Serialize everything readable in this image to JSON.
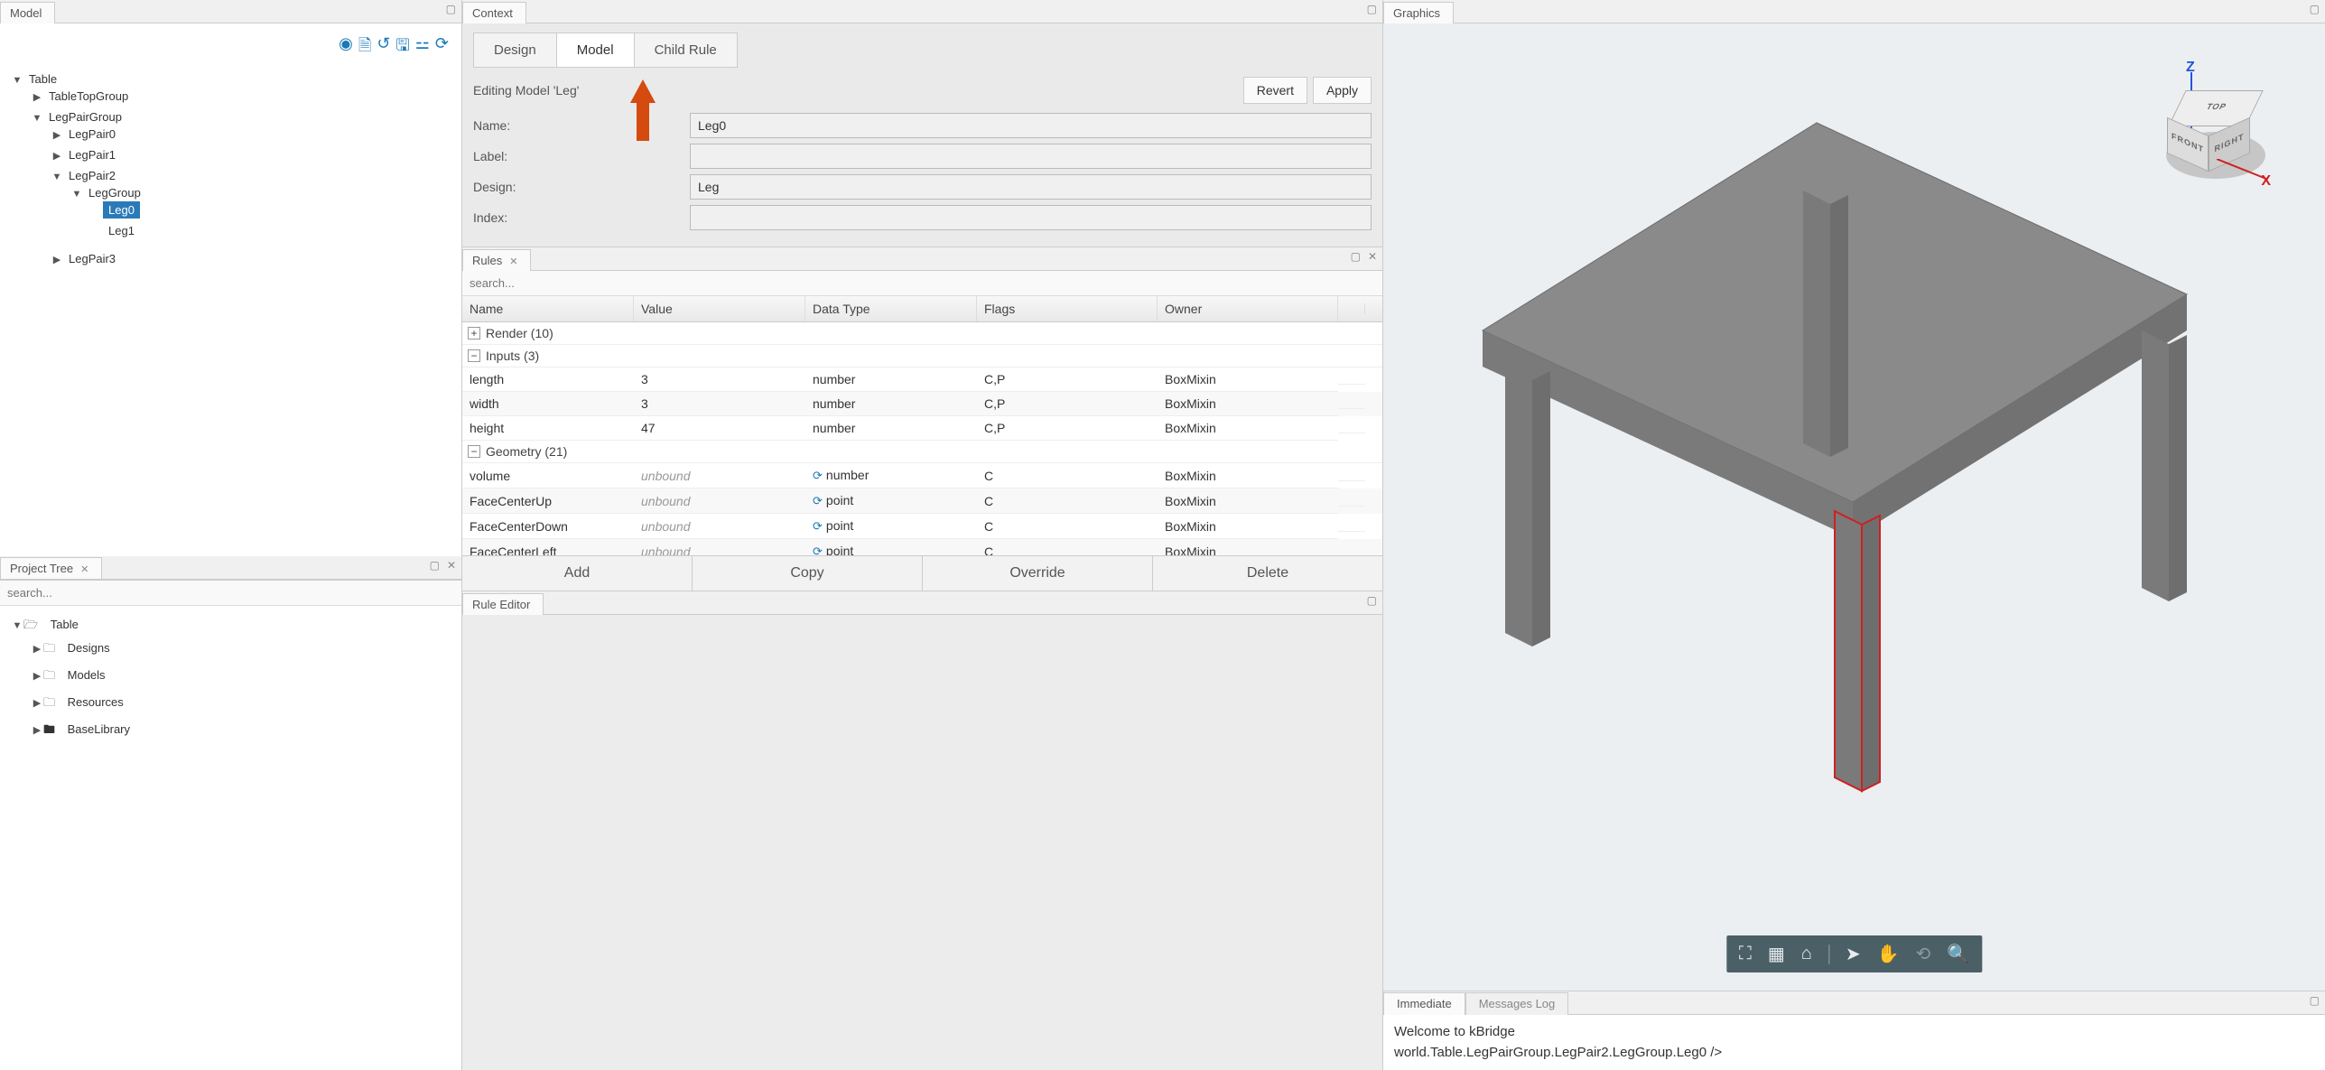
{
  "model_panel": {
    "title": "Model",
    "toolbar_icons": [
      "user-icon",
      "document-icon",
      "history-icon",
      "save-icon",
      "hierarchy-icon",
      "refresh-icon"
    ],
    "tree": {
      "root": "Table",
      "children": [
        {
          "label": "TableTopGroup",
          "expanded": false
        },
        {
          "label": "LegPairGroup",
          "expanded": true,
          "children": [
            {
              "label": "LegPair0",
              "expanded": false
            },
            {
              "label": "LegPair1",
              "expanded": false
            },
            {
              "label": "LegPair2",
              "expanded": true,
              "children": [
                {
                  "label": "LegGroup",
                  "expanded": true,
                  "children": [
                    {
                      "label": "Leg0",
                      "selected": true
                    },
                    {
                      "label": "Leg1"
                    }
                  ]
                }
              ]
            },
            {
              "label": "LegPair3",
              "expanded": false
            }
          ]
        }
      ]
    }
  },
  "project_panel": {
    "title": "Project Tree",
    "search_placeholder": "search...",
    "root": "Table",
    "folders": [
      {
        "label": "Designs",
        "icon": "folder"
      },
      {
        "label": "Models",
        "icon": "folder"
      },
      {
        "label": "Resources",
        "icon": "folder"
      },
      {
        "label": "BaseLibrary",
        "icon": "folder-solid"
      }
    ]
  },
  "context_panel": {
    "title": "Context",
    "tabs": [
      "Design",
      "Model",
      "Child Rule"
    ],
    "active_tab": "Model",
    "editing_text": "Editing Model 'Leg'",
    "buttons": {
      "revert": "Revert",
      "apply": "Apply"
    },
    "fields": {
      "name": {
        "label": "Name:",
        "value": "Leg0"
      },
      "label": {
        "label": "Label:",
        "value": ""
      },
      "design": {
        "label": "Design:",
        "value": "Leg"
      },
      "index": {
        "label": "Index:",
        "value": ""
      }
    }
  },
  "rules_panel": {
    "title": "Rules",
    "search_placeholder": "search...",
    "columns": [
      "Name",
      "Value",
      "Data Type",
      "Flags",
      "Owner"
    ],
    "groups": [
      {
        "label": "Render",
        "count": 10,
        "collapsed": true
      },
      {
        "label": "Inputs",
        "count": 3,
        "collapsed": false,
        "rows": [
          {
            "name": "length",
            "value": "3",
            "type": "number",
            "flags": "C,P",
            "owner": "BoxMixin"
          },
          {
            "name": "width",
            "value": "3",
            "type": "number",
            "flags": "C,P",
            "owner": "BoxMixin"
          },
          {
            "name": "height",
            "value": "47",
            "type": "number",
            "flags": "C,P",
            "owner": "BoxMixin"
          }
        ]
      },
      {
        "label": "Geometry",
        "count": 21,
        "collapsed": false,
        "rows": [
          {
            "name": "volume",
            "value": "unbound",
            "type": "number",
            "flags": "C",
            "owner": "BoxMixin",
            "refresh": true
          },
          {
            "name": "FaceCenterUp",
            "value": "unbound",
            "type": "point",
            "flags": "C",
            "owner": "BoxMixin",
            "refresh": true
          },
          {
            "name": "FaceCenterDown",
            "value": "unbound",
            "type": "point",
            "flags": "C",
            "owner": "BoxMixin",
            "refresh": true
          },
          {
            "name": "FaceCenterLeft",
            "value": "unbound",
            "type": "point",
            "flags": "C",
            "owner": "BoxMixin",
            "refresh": true,
            "cut": true
          }
        ]
      }
    ],
    "actions": [
      "Add",
      "Copy",
      "Override",
      "Delete"
    ]
  },
  "rule_editor": {
    "title": "Rule Editor"
  },
  "graphics_panel": {
    "title": "Graphics",
    "axes": {
      "z": "Z",
      "x": "X"
    },
    "viewcube": {
      "top": "TOP",
      "front": "FRONT",
      "right": "RIGHT"
    },
    "toolbar_icons": [
      "fullscreen-icon",
      "grid-icon",
      "home-icon",
      "divider",
      "pointer-icon",
      "hand-icon",
      "orbit-icon",
      "search-icon"
    ]
  },
  "immediate_panel": {
    "tabs": [
      "Immediate",
      "Messages Log"
    ],
    "active_tab": "Immediate",
    "lines": [
      "Welcome to kBridge",
      "world.Table.LegPairGroup.LegPair2.LegGroup.Leg0 />"
    ]
  }
}
